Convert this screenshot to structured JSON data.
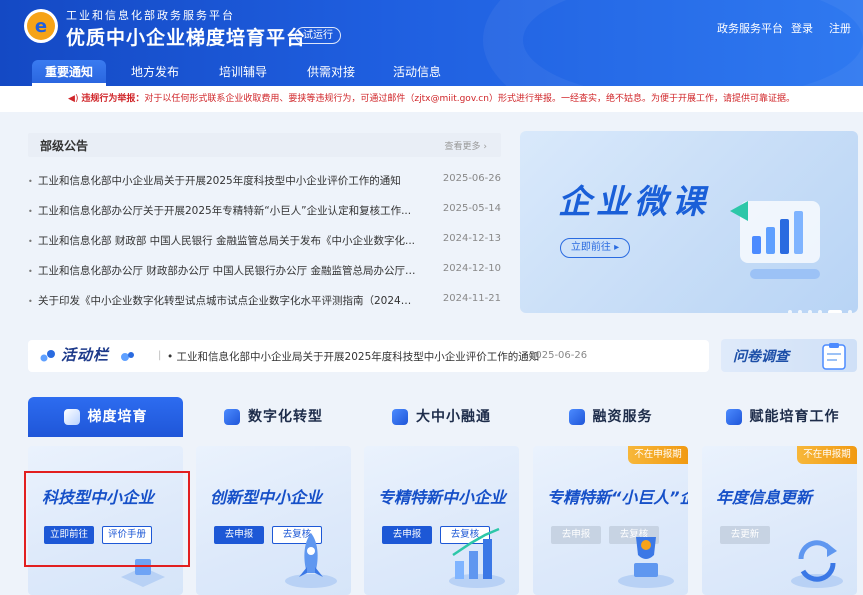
{
  "header": {
    "org_name": "工业和信息化部政务服务平台",
    "site_title": "优质中小企业梯度培育平台",
    "beta_badge": "试运行",
    "links": [
      "政务服务平台",
      "登录",
      "注册"
    ]
  },
  "nav": {
    "tabs": [
      "重要通知",
      "地方发布",
      "培训辅导",
      "供需对接",
      "活动信息"
    ],
    "active_index": 0
  },
  "notice": {
    "prefix": "违规行为举报：",
    "text": "对于以任何形式联系企业收取费用、要挟等违规行为，可通过邮件（zjtx@miit.gov.cn）形式进行举报。一经查实，绝不姑息。为便于开展工作，请提供可靠证据。"
  },
  "announcements": {
    "title": "部级公告",
    "more": "查看更多",
    "items": [
      {
        "text": "工业和信息化部中小企业局关于开展2025年度科技型中小企业评价工作的通知",
        "date": "2025-06-26"
      },
      {
        "text": "工业和信息化部办公厅关于开展2025年专精特新“小巨人”企业认定和复核工作...",
        "date": "2025-05-14"
      },
      {
        "text": "工业和信息化部 财政部 中国人民银行 金融监管总局关于发布《中小企业数字化...",
        "date": "2024-12-13"
      },
      {
        "text": "工业和信息化部办公厅 财政部办公厅 中国人民银行办公厅 金融监管总局办公厅 ...",
        "date": "2024-12-10"
      },
      {
        "text": "关于印发《中小企业数字化转型试点城市试点企业数字化水平评测指南（2024年...",
        "date": "2024-11-21"
      }
    ]
  },
  "banner": {
    "title": "企业微课",
    "button": "立即前往 ▸"
  },
  "activity": {
    "label": "活动栏",
    "text": "工业和信息化部中小企业局关于开展2025年度科技型中小企业评价工作的通知",
    "date": "2025-06-26"
  },
  "survey": {
    "label": "问卷调查"
  },
  "categories": {
    "tabs": [
      "梯度培育",
      "数字化转型",
      "大中小融通",
      "融资服务",
      "赋能培育工作"
    ],
    "active_index": 0
  },
  "cards": [
    {
      "title": "科技型中小企业",
      "buttons": [
        "立即前往",
        "评价手册"
      ],
      "status": ""
    },
    {
      "title": "创新型中小企业",
      "buttons": [
        "去申报",
        "去复核"
      ],
      "status": ""
    },
    {
      "title": "专精特新中小企业",
      "buttons": [
        "去申报",
        "去复核"
      ],
      "status": ""
    },
    {
      "title": "专精特新“小巨人”企业",
      "buttons": [
        "去申报",
        "去复核"
      ],
      "status": "不在申报期"
    },
    {
      "title": "年度信息更新",
      "buttons": [
        "去更新"
      ],
      "status": "不在申报期"
    }
  ],
  "colors": {
    "brand_blue": "#1f5fe0",
    "notice_red": "#d0262a",
    "status_orange": "#f19a12",
    "highlight_red": "#e21f1f"
  }
}
